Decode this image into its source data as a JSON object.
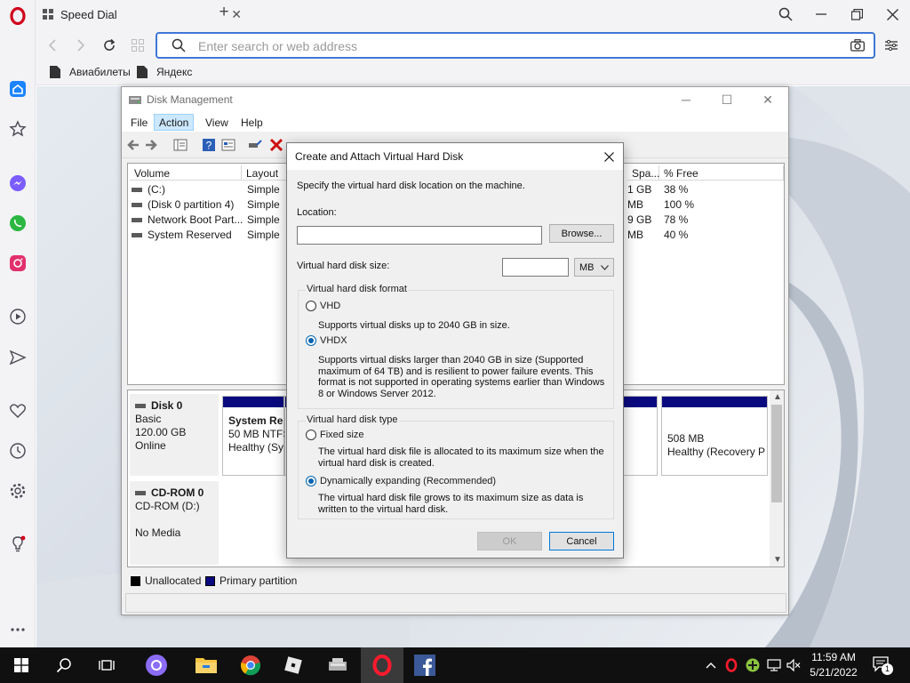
{
  "browser": {
    "tab_title": "Speed Dial",
    "address_placeholder": "Enter search or web address",
    "bookmarks": [
      {
        "label": "Авиабилеты"
      },
      {
        "label": "Яндекс"
      }
    ],
    "sidebar_icons": [
      "home-icon",
      "bookmark-star-icon",
      "messenger-icon",
      "whatsapp-icon",
      "instagram-icon",
      "player-icon",
      "send-icon",
      "heart-icon",
      "history-clock-icon",
      "settings-gear-icon",
      "lightbulb-icon",
      "more-dots-icon"
    ],
    "accent_color": "#d0021b"
  },
  "disk_mgmt": {
    "title": "Disk Management",
    "menu": [
      "File",
      "Action",
      "View",
      "Help"
    ],
    "active_menu": "Action",
    "columns": [
      "Volume",
      "Layout",
      "Spa...",
      "% Free"
    ],
    "volumes": [
      {
        "volume": "(C:)",
        "layout": "Simple",
        "space": "1 GB",
        "free": "38 %"
      },
      {
        "volume": "(Disk 0 partition 4)",
        "layout": "Simple",
        "space": "MB",
        "free": "100 %"
      },
      {
        "volume": "Network Boot Part...",
        "layout": "Simple",
        "space": "9 GB",
        "free": "78 %"
      },
      {
        "volume": "System Reserved",
        "layout": "Simple",
        "space": "MB",
        "free": "40 %"
      }
    ],
    "disks": [
      {
        "name": "Disk 0",
        "type": "Basic",
        "size": "120.00 GB",
        "status": "Online",
        "partitions": [
          {
            "name": "System Re",
            "size": "50 MB NTFS",
            "status": "Healthy (Sy"
          },
          {
            "name": "",
            "size": "508 MB",
            "status": "Healthy (Recovery P"
          }
        ]
      },
      {
        "name": "CD-ROM 0",
        "type": "CD-ROM (D:)",
        "size": "",
        "status": "No Media",
        "partitions": []
      }
    ],
    "legend": [
      {
        "label": "Unallocated",
        "color": "#000000"
      },
      {
        "label": "Primary partition",
        "color": "#0a0a80"
      }
    ]
  },
  "dialog": {
    "title": "Create and Attach Virtual Hard Disk",
    "instruction": "Specify the virtual hard disk location on the machine.",
    "location_label": "Location:",
    "location_value": "",
    "browse_label": "Browse...",
    "size_label": "Virtual hard disk size:",
    "size_value": "",
    "size_unit": "MB",
    "format_group": "Virtual hard disk format",
    "format_options": [
      {
        "label": "VHD",
        "selected": false,
        "description": "Supports virtual disks up to 2040 GB in size."
      },
      {
        "label": "VHDX",
        "selected": true,
        "description": "Supports virtual disks larger than 2040 GB in size (Supported maximum of 64 TB) and is resilient to power failure events. This format is not supported in operating systems earlier than Windows 8 or Windows Server 2012."
      }
    ],
    "type_group": "Virtual hard disk type",
    "type_options": [
      {
        "label": "Fixed size",
        "selected": false,
        "description": "The virtual hard disk file is allocated to its maximum size when the virtual hard disk is created."
      },
      {
        "label": "Dynamically expanding (Recommended)",
        "selected": true,
        "description": "The virtual hard disk file grows to its maximum size as data is written to the virtual hard disk."
      }
    ],
    "ok_label": "OK",
    "cancel_label": "Cancel"
  },
  "taskbar": {
    "time": "11:59 AM",
    "date": "5/21/2022",
    "notification_count": "1",
    "apps": [
      "start-icon",
      "search-icon",
      "task-view-icon",
      "cortana-icon",
      "file-explorer-icon",
      "chrome-icon",
      "roblox-icon",
      "disk-tool-icon",
      "opera-icon",
      "facebook-icon"
    ]
  }
}
